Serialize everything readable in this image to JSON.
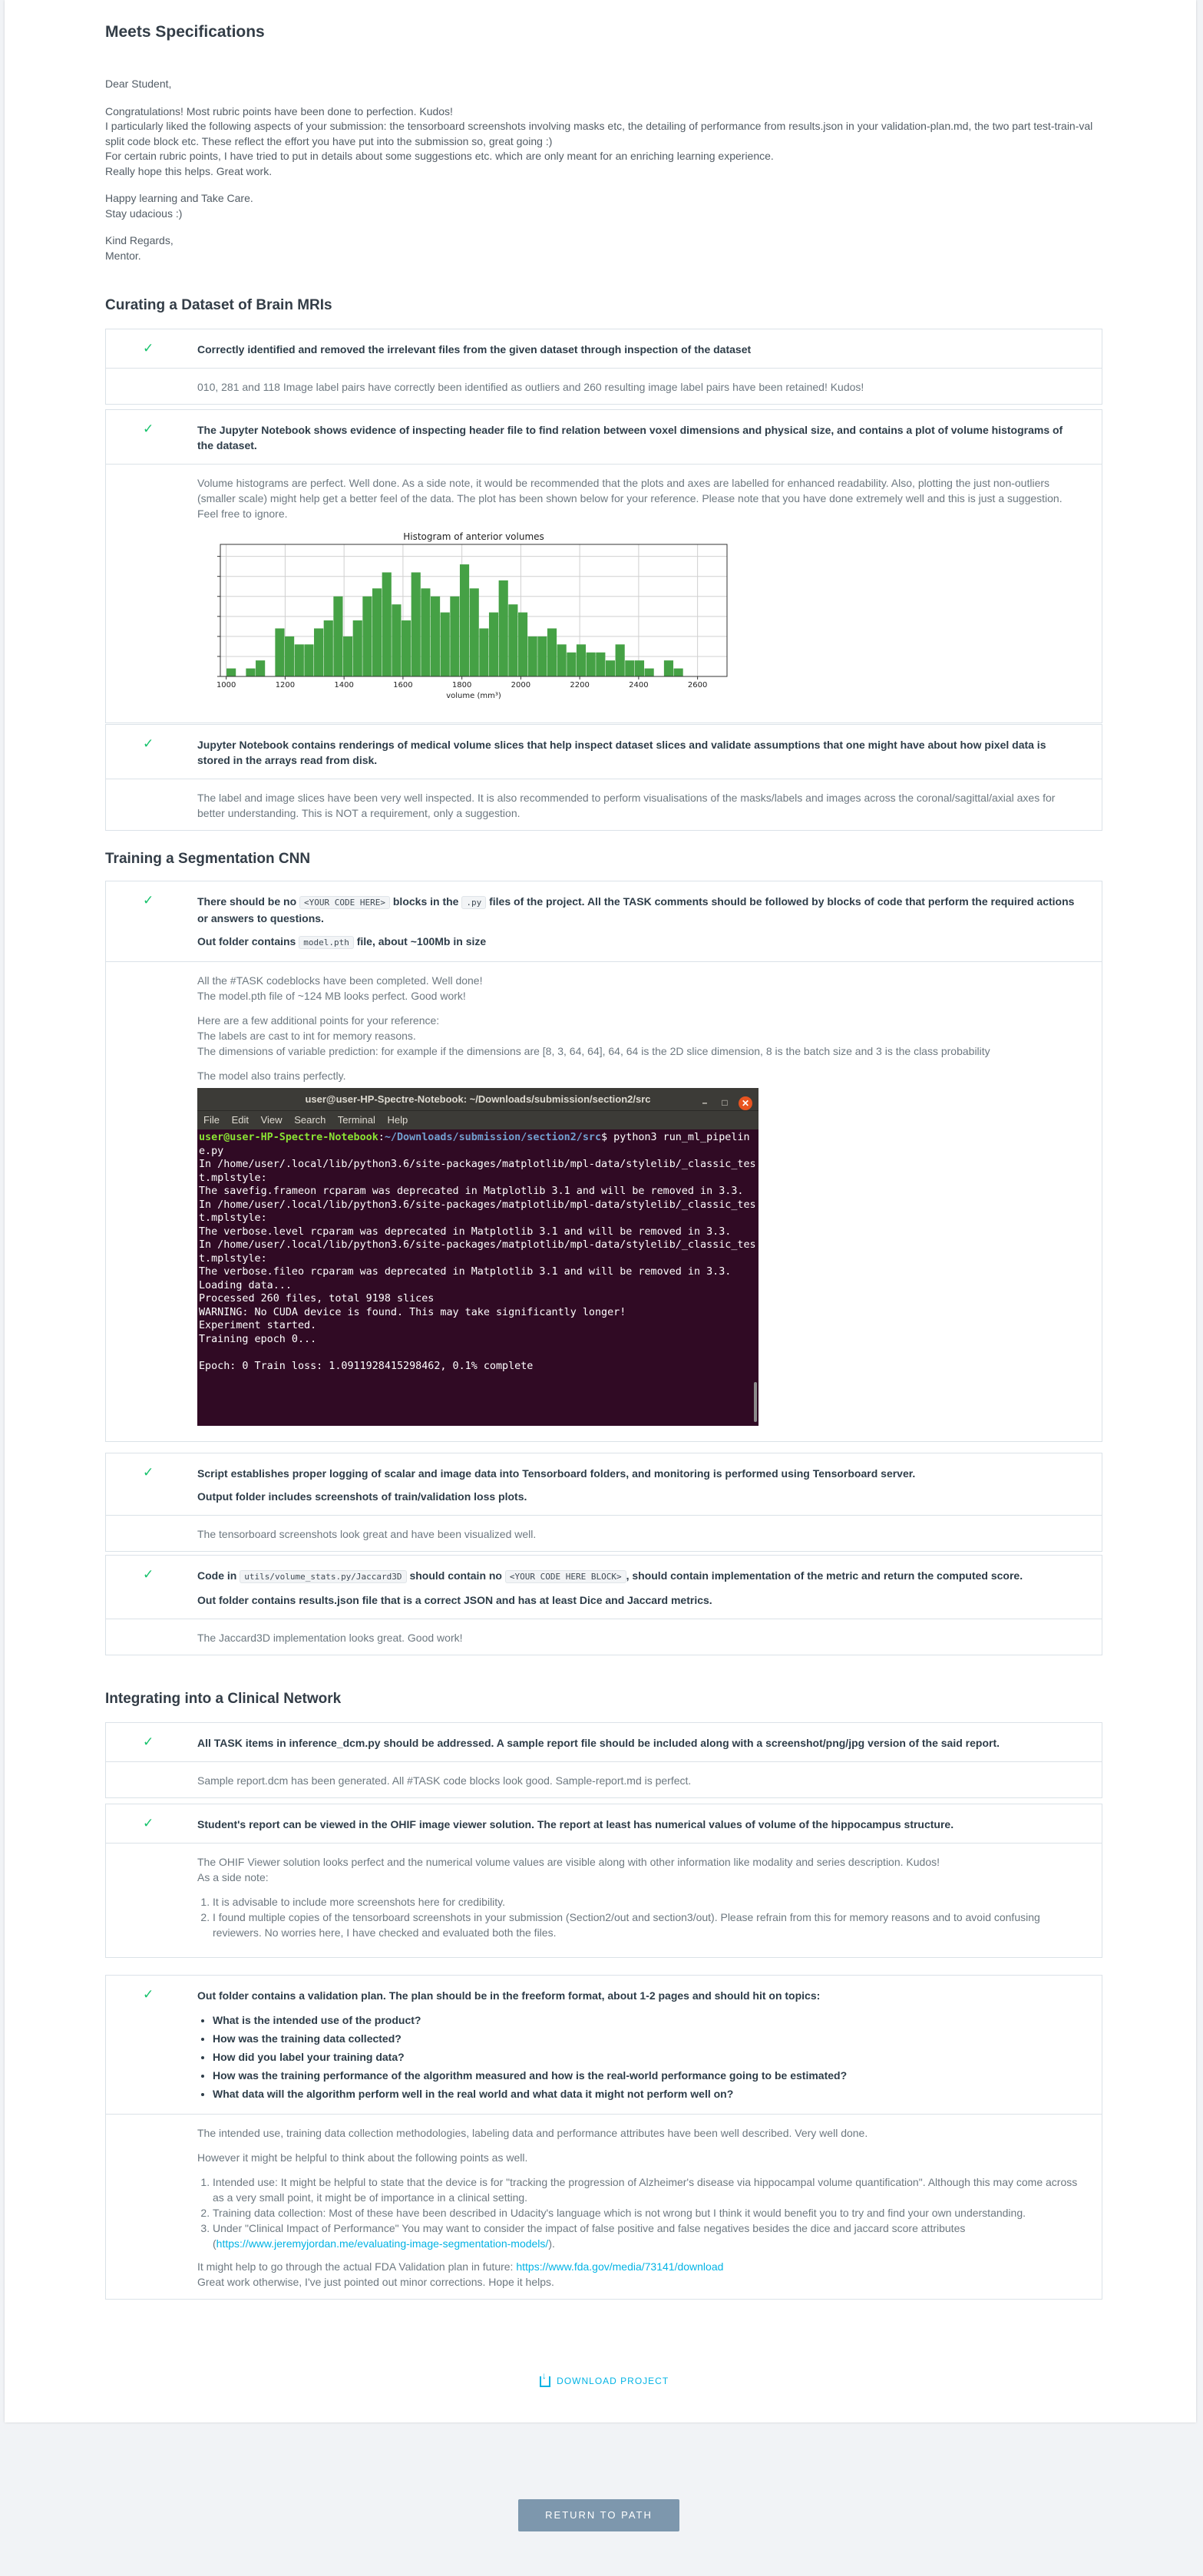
{
  "header": {
    "title": "Meets Specifications"
  },
  "letter": {
    "greeting": "Dear Student,",
    "p1": "Congratulations! Most rubric points have been done to perfection. Kudos!",
    "p2": "I particularly liked the following aspects of your submission: the tensorboard screenshots involving masks etc, the detailing of performance from results.json in your validation-plan.md, the two part test-train-val split code block etc. These reflect the effort you have put into the submission so, great going :)",
    "p3": "For certain rubric points, I have tried to put in details about some suggestions etc. which are only meant for an enriching learning experience.",
    "p4": "Really hope this helps. Great work.",
    "closing1": "Happy learning and Take Care.",
    "closing2": "Stay udacious :)",
    "signoff1": "Kind Regards,",
    "signoff2": "Mentor."
  },
  "sections": {
    "s1": "Curating a Dataset of Brain MRIs",
    "s2": "Training a Segmentation CNN",
    "s3": "Integrating into a Clinical Network"
  },
  "rubric": {
    "r1": {
      "criterion": "Correctly identified and removed the irrelevant files from the given dataset through inspection of the dataset",
      "review": "010, 281 and 118 Image label pairs have correctly been identified as outliers and 260 resulting image label pairs have been retained! Kudos!"
    },
    "r2": {
      "criterion": "The Jupyter Notebook shows evidence of inspecting header file to find relation between voxel dimensions and physical size, and contains a plot of volume histograms of the dataset.",
      "review": "Volume histograms are perfect. Well done. As a side note, it would be recommended that the plots and axes are labelled for enhanced readability. Also, plotting the just non-outliers (smaller scale) might help get a better feel of the data. The plot has been shown below for your reference. Please note that you have done extremely well and this is just a suggestion. Feel free to ignore."
    },
    "r3": {
      "criterion": "Jupyter Notebook contains renderings of medical volume slices that help inspect dataset slices and validate assumptions that one might have about how pixel data is stored in the arrays read from disk.",
      "review": "The label and image slices have been very well inspected. It is also recommended to perform visualisations of the masks/labels and images across the coronal/sagittal/axial axes for better understanding. This is NOT a requirement, only a suggestion."
    },
    "r4": {
      "c1a": "There should be no",
      "c1code": "<YOUR CODE HERE>",
      "c1b": "blocks in the",
      "c1code2": ".py",
      "c1c": "files of the project. All the TASK comments should be followed by blocks of code that perform the required actions or answers to questions.",
      "c2a": "Out folder contains",
      "c2code": "model.pth",
      "c2b": "file, about ~100Mb in size",
      "rv1": "All the #TASK codeblocks have been completed. Well done!",
      "rv2": "The model.pth file of ~124 MB looks perfect. Good work!",
      "rv3": "Here are a few additional points for your reference:",
      "rv4": "The labels are cast to int for memory reasons.",
      "rv5": "The dimensions of variable prediction: for example if the dimensions are [8, 3, 64, 64], 64, 64 is the 2D slice dimension, 8 is the batch size and 3 is the class probability",
      "rv6": "The model also trains perfectly."
    },
    "r5": {
      "criterion": "Script establishes proper logging of scalar and image data into Tensorboard folders, and monitoring is performed using Tensorboard server.",
      "criterion2": "Output folder includes screenshots of train/validation loss plots.",
      "review": "The tensorboard screenshots look great and have been visualized well."
    },
    "r6": {
      "c1a": "Code in",
      "c1code": "utils/volume_stats.py/Jaccard3D",
      "c1b": "should contain no",
      "c1code2": "<YOUR CODE HERE BLOCK>",
      "c1c": ", should contain implementation of the metric and return the computed score.",
      "c2": "Out folder contains results.json file that is a correct JSON and has at least Dice and Jaccard metrics.",
      "review": "The Jaccard3D implementation looks great. Good work!"
    },
    "r7": {
      "criterion": "All TASK items in inference_dcm.py should be addressed. A sample report file should be included along with a screenshot/png/jpg version of the said report.",
      "review": "Sample report.dcm has been generated. All #TASK code blocks look good. Sample-report.md is perfect."
    },
    "r8": {
      "criterion": "Student's report can be viewed in the OHIF image viewer solution. The report at least has numerical values of volume of the hippocampus structure.",
      "rv1": "The OHIF Viewer solution looks perfect and the numerical volume values are visible along with other information like modality and series description. Kudos!",
      "rv2": "As a side note:",
      "li1": "It is advisable to include more screenshots here for credibility.",
      "li2": "I found multiple copies of the tensorboard screenshots in your submission (Section2/out and section3/out). Please refrain from this for memory reasons and to avoid confusing reviewers. No worries here, I have checked and evaluated both the files."
    },
    "r9": {
      "criterion": "Out folder contains a validation plan. The plan should be in the freeform format, about 1-2 pages and should hit on topics:",
      "q1": "What is the intended use of the product?",
      "q2": "How was the training data collected?",
      "q3": "How did you label your training data?",
      "q4": "How was the training performance of the algorithm measured and how is the real-world performance going to be estimated?",
      "q5": "What data will the algorithm perform well in the real world and what data it might not perform well on?",
      "rv1": "The intended use, training data collection methodologies, labeling data and performance attributes have been well described. Very well done.",
      "rv2": "However it might be helpful to think about the following points as well.",
      "li1": "Intended use: It might be helpful to state that the device is for \"tracking the progression of Alzheimer's disease via hippocampal volume quantification\". Although this may come across as a very small point, it might be of importance in a clinical setting.",
      "li2": "Training data collection: Most of these have been described in Udacity's language which is not wrong but I think it would benefit you to try and find your own understanding.",
      "li3a": "Under \"Clinical Impact of Performance\" You may want to consider the impact of false positive and false negatives besides the dice and jaccard score attributes (",
      "li3link": "https://www.jeremyjordan.me/evaluating-image-segmentation-models/",
      "li3b": ").",
      "rv3a": "It might help to go through the actual FDA Validation plan in future:",
      "rv3link": "https://www.fda.gov/media/73141/download",
      "rv4": "Great work otherwise, I've just pointed out minor corrections. Hope it helps."
    }
  },
  "terminal": {
    "title": "user@user-HP-Spectre-Notebook: ~/Downloads/submission/section2/src",
    "menu": [
      "File",
      "Edit",
      "View",
      "Search",
      "Terminal",
      "Help"
    ],
    "prompt_user": "user@user-HP-Spectre-Notebook",
    "prompt_sep": ":",
    "prompt_path": "~/Downloads/submission/section2/src",
    "command": "$ python3 run_ml_pipeline.py",
    "output": "In /home/user/.local/lib/python3.6/site-packages/matplotlib/mpl-data/stylelib/_classic_test.mplstyle:\nThe savefig.frameon rcparam was deprecated in Matplotlib 3.1 and will be removed in 3.3.\nIn /home/user/.local/lib/python3.6/site-packages/matplotlib/mpl-data/stylelib/_classic_test.mplstyle:\nThe verbose.level rcparam was deprecated in Matplotlib 3.1 and will be removed in 3.3.\nIn /home/user/.local/lib/python3.6/site-packages/matplotlib/mpl-data/stylelib/_classic_test.mplstyle:\nThe verbose.fileo rcparam was deprecated in Matplotlib 3.1 and will be removed in 3.3.\nLoading data...\nProcessed 260 files, total 9198 slices\nWARNING: No CUDA device is found. This may take significantly longer!\nExperiment started.\nTraining epoch 0...\n\nEpoch: 0 Train loss: 1.0911928415298462, 0.1% complete"
  },
  "chart_data": {
    "type": "bar",
    "title": "Histogram of anterior volumes",
    "xlabel": "volume (mm³)",
    "ylabel": "",
    "xlim": [
      980,
      2700
    ],
    "ylim": [
      0,
      16.5
    ],
    "xticks": [
      1000,
      1200,
      1400,
      1600,
      1800,
      2000,
      2200,
      2400,
      2600
    ],
    "bin_width": 33,
    "bins": [
      1001,
      1034,
      1067,
      1100,
      1133,
      1166,
      1199,
      1232,
      1265,
      1298,
      1331,
      1364,
      1397,
      1430,
      1463,
      1496,
      1529,
      1562,
      1595,
      1628,
      1661,
      1694,
      1727,
      1760,
      1793,
      1826,
      1859,
      1892,
      1925,
      1958,
      1991,
      2024,
      2057,
      2090,
      2123,
      2156,
      2189,
      2222,
      2255,
      2288,
      2321,
      2354,
      2387,
      2420,
      2453,
      2486,
      2519,
      2552
    ],
    "values": [
      1,
      0,
      1,
      2,
      0,
      6,
      5,
      4,
      4,
      6,
      7,
      10,
      5,
      7,
      10,
      11,
      13,
      9,
      7,
      13,
      11,
      10,
      8,
      10,
      14,
      11,
      6,
      8,
      12,
      9,
      8,
      5,
      5,
      6,
      4,
      3,
      4,
      3,
      3,
      2,
      4,
      2,
      2,
      1,
      0,
      2,
      1,
      0
    ],
    "color": "#45a145"
  },
  "footer": {
    "download": "DOWNLOAD PROJECT",
    "return": "RETURN TO PATH"
  }
}
